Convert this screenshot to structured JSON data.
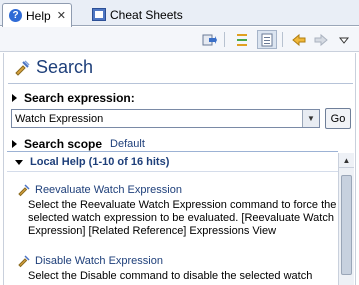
{
  "tabs": {
    "help_label": "Help",
    "help_close": "✕",
    "cheat_label": "Cheat Sheets"
  },
  "toolbar": {
    "icons": [
      "synchronize-icon",
      "show-all-icon",
      "show-in-toc-icon",
      "back-icon",
      "forward-icon",
      "view-menu-icon"
    ]
  },
  "page": {
    "title": "Search"
  },
  "search_expression": {
    "label": "Search expression:",
    "value": "Watch Expression",
    "go_label": "Go"
  },
  "search_scope": {
    "label": "Search scope",
    "value": "Default"
  },
  "results": {
    "header": "Local Help (1-10 of 16 hits)",
    "items": [
      {
        "title": "Reevaluate Watch Expression",
        "desc": "Select the Reevaluate Watch Expression command to force the selected watch expression to be evaluated. [Reevaluate Watch Expression] [Related Reference] Expressions View"
      },
      {
        "title": "Disable Watch Expression",
        "desc": "Select the Disable command to disable the selected watch"
      }
    ]
  },
  "colors": {
    "link": "#1e3f7a",
    "tab_bar": "#e9eef6"
  }
}
